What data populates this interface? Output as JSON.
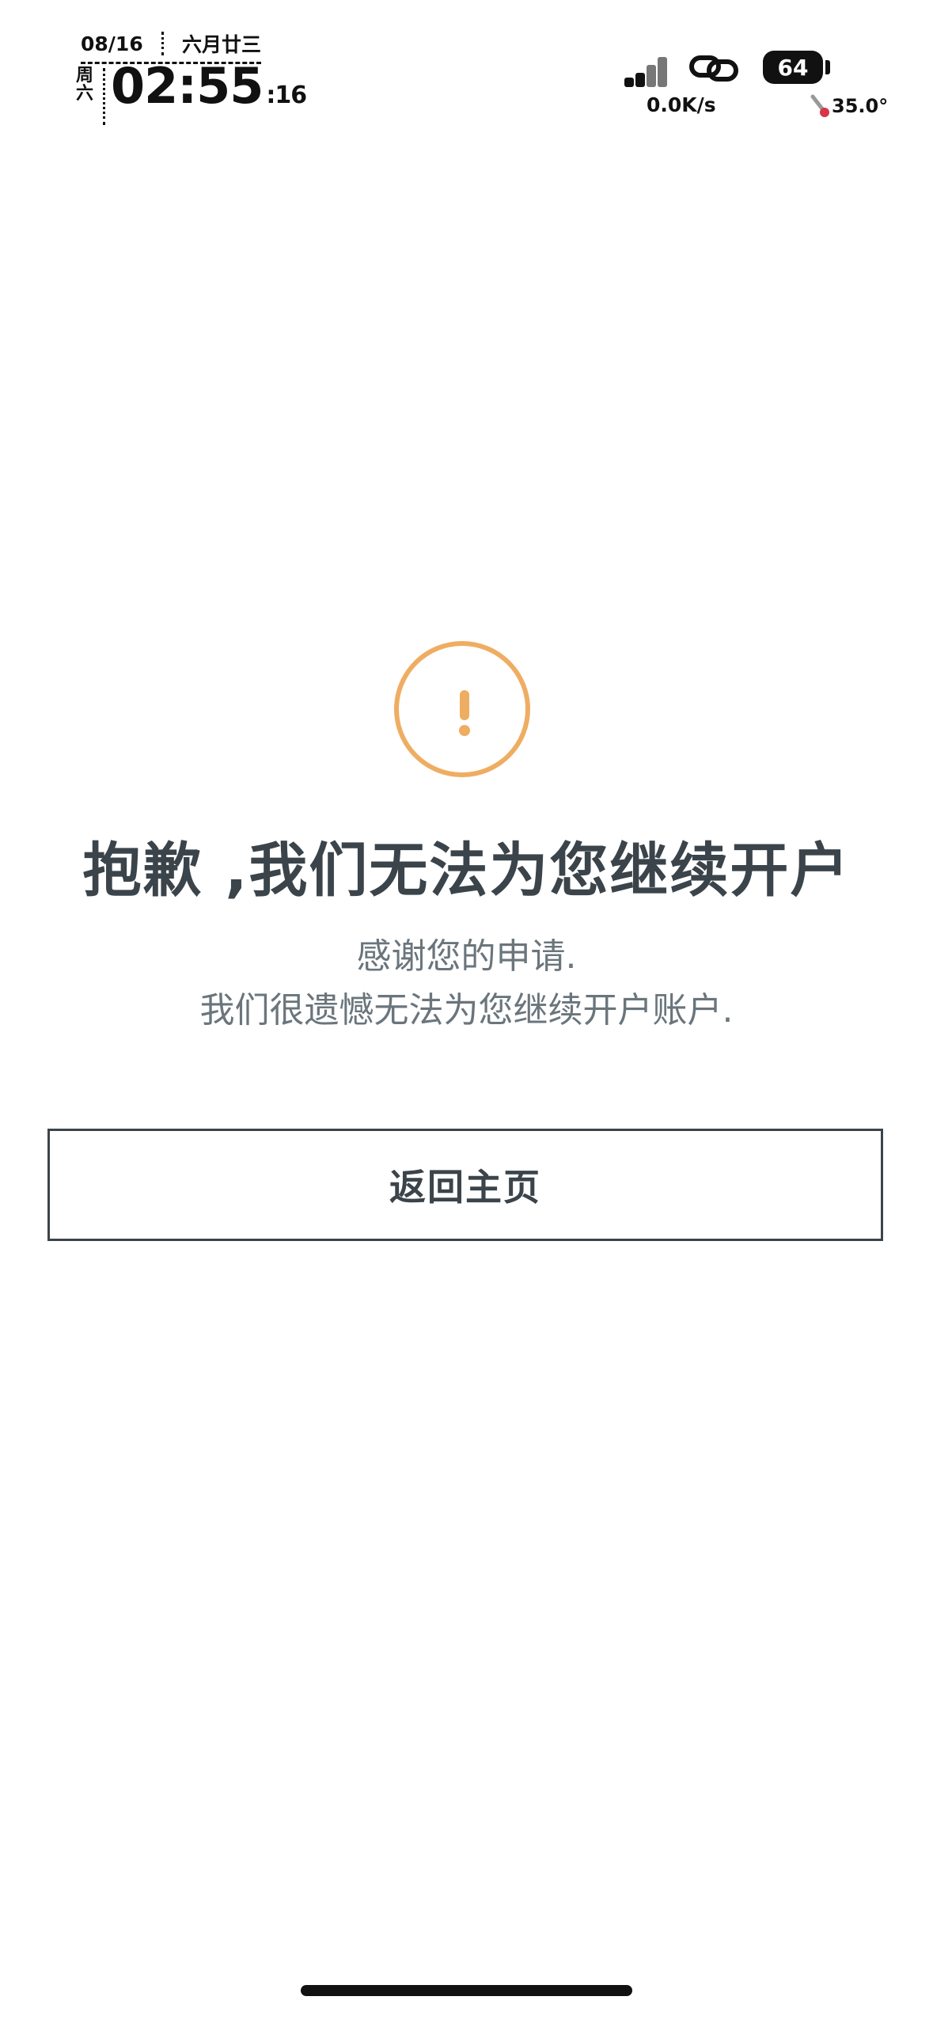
{
  "status_bar": {
    "date": "08/16",
    "lunar_date": "六月廿三",
    "weekday_line1": "周",
    "weekday_line2": "六",
    "time_hm": "02:55",
    "time_seconds": ":16",
    "battery_level": "64",
    "network_speed": "0.0K/s",
    "temperature": "35.0°"
  },
  "notice": {
    "icon": "warning-exclamation-icon",
    "accent_color": "#efad62",
    "title": "抱歉 ,我们无法为您继续开户",
    "message_line1": "感谢您的申请.",
    "message_line2": "我们很遗憾无法为您继续开户账户."
  },
  "actions": {
    "home_label": "返回主页"
  },
  "colors": {
    "text_primary": "#3b444a",
    "text_secondary": "#6a757c"
  }
}
